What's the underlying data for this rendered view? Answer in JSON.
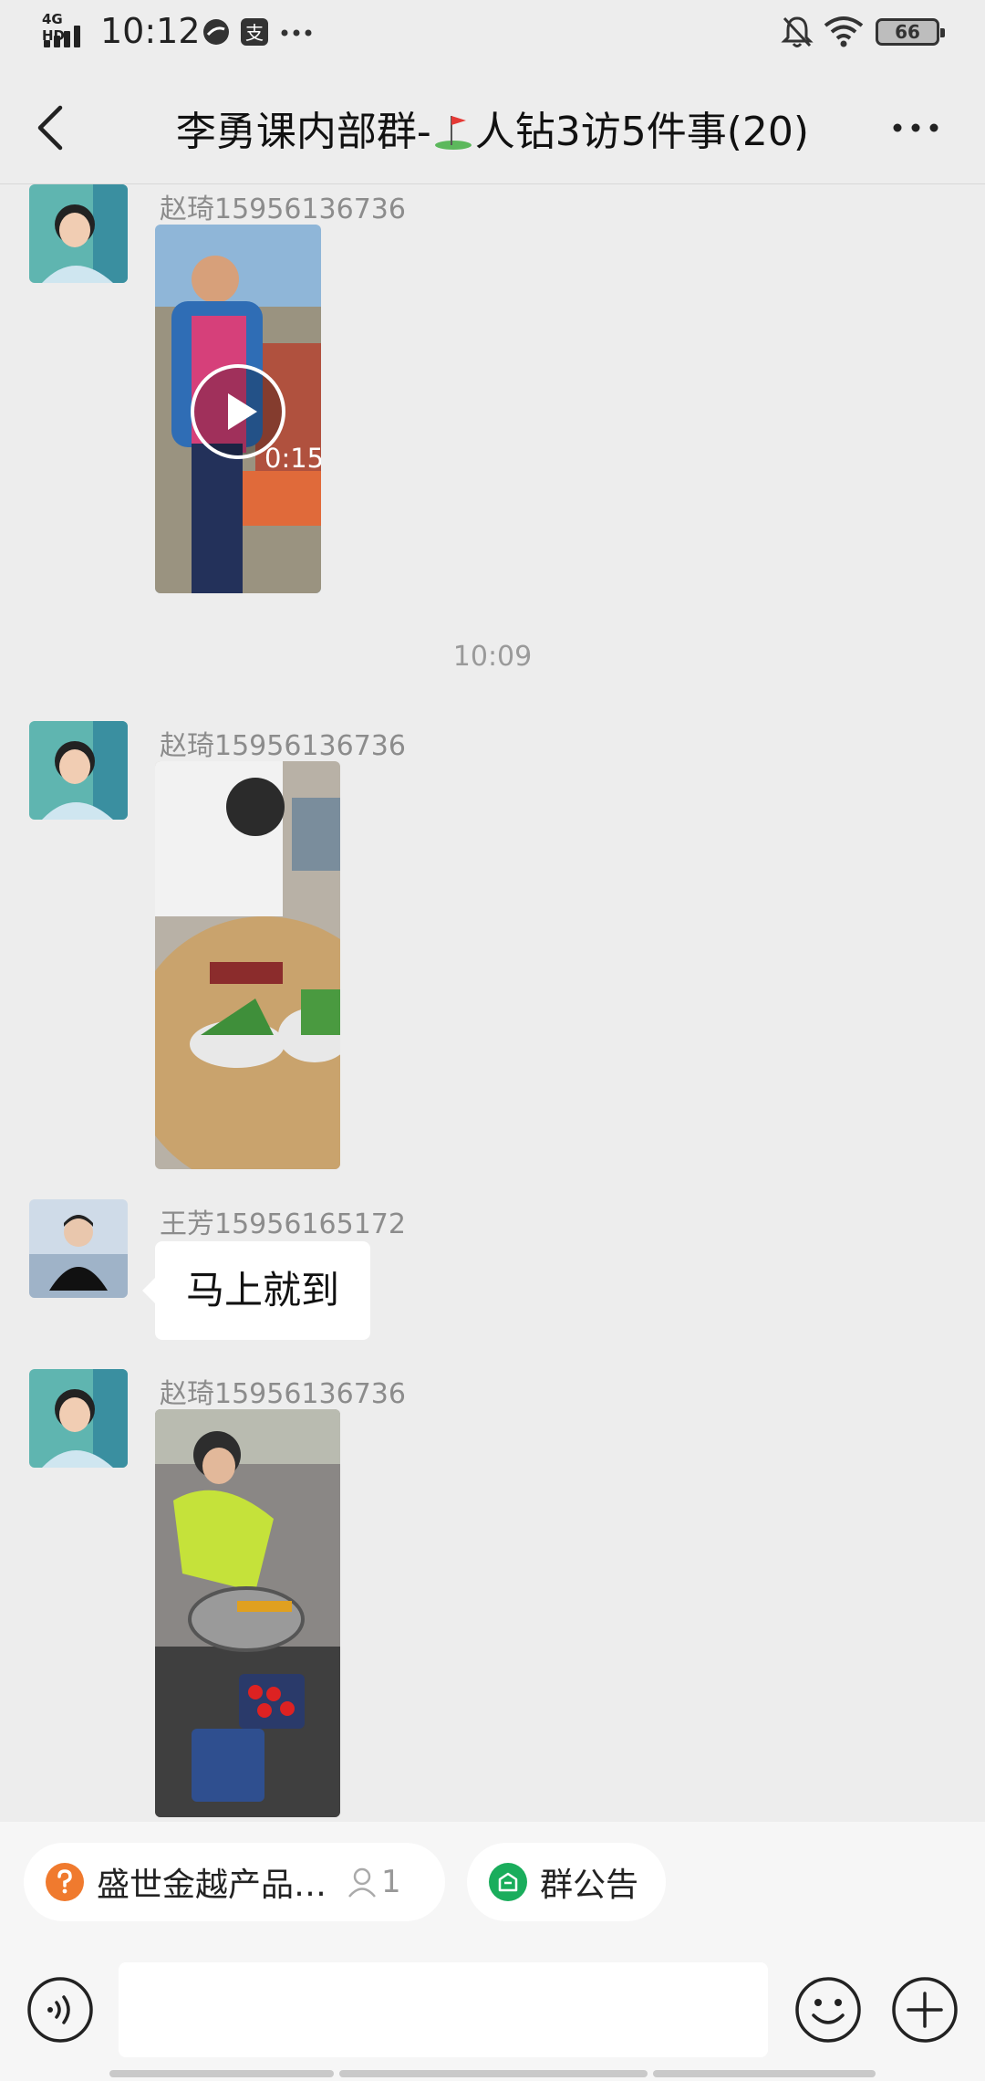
{
  "status_bar": {
    "network": "4G HD",
    "time": "10:12",
    "battery": "66"
  },
  "nav": {
    "title_prefix": "李勇课内部群-",
    "title_suffix": "人钻3访5件事(20)",
    "title_icon": "golf-flag-icon"
  },
  "messages": [
    {
      "type": "video",
      "sender": "赵琦15956136736",
      "duration": "0:15"
    },
    {
      "type": "time",
      "text": "10:09"
    },
    {
      "type": "image",
      "sender": "赵琦15956136736"
    },
    {
      "type": "text",
      "sender": "王芳15956165172",
      "text": "马上就到"
    },
    {
      "type": "image",
      "sender": "赵琦15956136736"
    }
  ],
  "chips": [
    {
      "label": "盛世金越产品…",
      "count": "1",
      "icon": "question-icon",
      "color": "#f07a2e"
    },
    {
      "label": "群公告",
      "icon": "announcement-icon",
      "color": "#1aad5c"
    }
  ],
  "input": {
    "placeholder": ""
  }
}
